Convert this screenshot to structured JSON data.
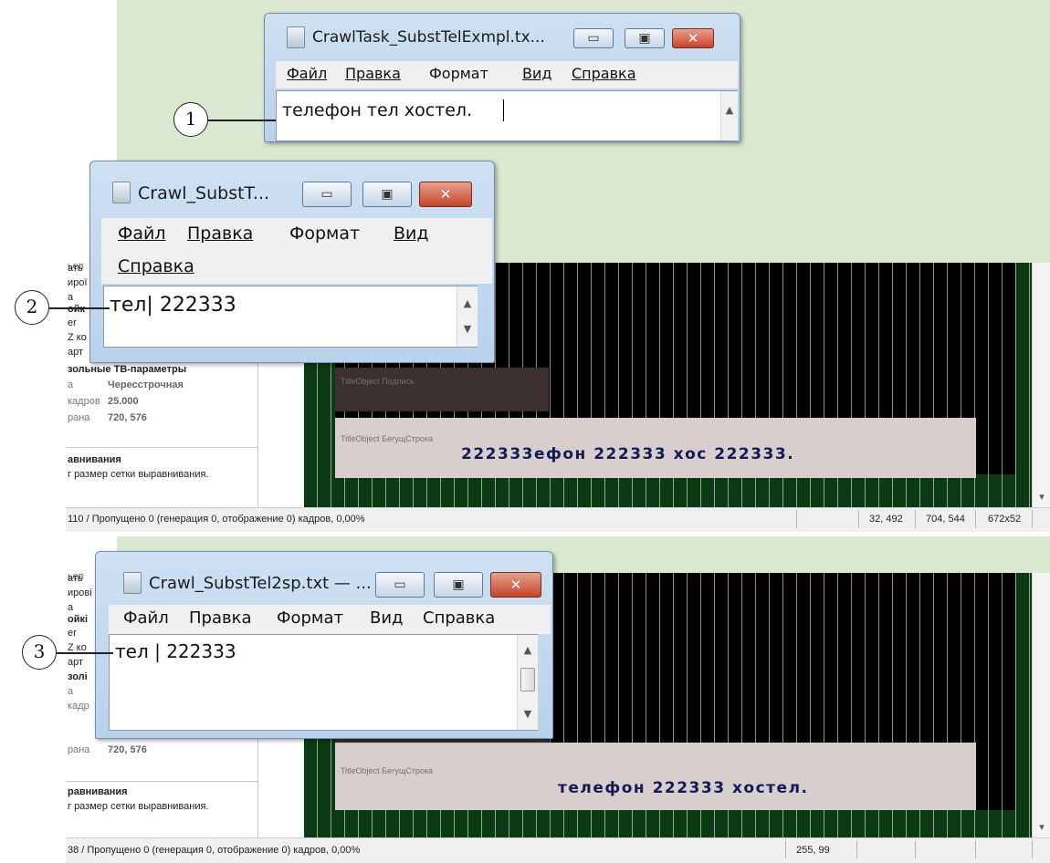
{
  "callouts": [
    "1",
    "2",
    "3"
  ],
  "window1": {
    "title": "CrawlTask_SubstTelExmpl.tx...",
    "menu": [
      "Файл",
      "Правка",
      "Формат",
      "Вид",
      "Справка"
    ],
    "text": "телефон тел хостел."
  },
  "window2": {
    "title": "Crawl_SubstT...",
    "menu": [
      "Файл",
      "Правка",
      "Формат",
      "Вид",
      "Справка"
    ],
    "text": "тел| 222333"
  },
  "window3": {
    "title": "Crawl_SubstTel2sp.txt — ...",
    "menu": [
      "Файл",
      "Правка",
      "Формат",
      "Вид",
      "Справка"
    ],
    "text": "тел | 222333"
  },
  "app1": {
    "left_fragments": [
      "ьев",
      "ать",
      "ирої",
      "а",
      "ойк",
      "er",
      "Z ко",
      "арт"
    ],
    "section_title": "зольные ТВ-параметры",
    "props": [
      {
        "label": "а",
        "value": "Чересстрочная"
      },
      {
        "label": "кадров",
        "value": "25.000"
      },
      {
        "label": "рана",
        "value": "720, 576"
      }
    ],
    "help_title": "авнивания",
    "help_text": "г размер сетки выравнивания.",
    "caption_label": "TitleObject Подпись",
    "crawl_label": "TitleObject БегущСтрока",
    "crawl_text": "222333ефон  222333  хос 222333.",
    "status": {
      "text": "110 / Пропущено 0 (генерация 0, отображение 0) кадров,  0,00%",
      "coords": "32, 492",
      "pos": "704, 544",
      "size": "672x52"
    }
  },
  "app2": {
    "left_fragments": [
      "ьев",
      "ать",
      "ирові",
      "а",
      "ойкі",
      "er",
      "Z ко",
      "арт",
      "золі",
      "а",
      "кадр"
    ],
    "props": [
      {
        "label": "рана",
        "value": "720, 576"
      }
    ],
    "help_title": "равнивания",
    "help_text": "г размер сетки выравнивания.",
    "crawl_label": "TitleObject БегущСтрока",
    "crawl_text": "телефон 222333 хостел.",
    "status": {
      "text": "38 / Пропущено 0 (генерация 0, отображение 0) кадров,  0,00%",
      "coords": "255, 99"
    }
  },
  "icons": {
    "minimize": "minimize-icon",
    "maximize": "maximize-icon",
    "close": "close-icon",
    "scroll_up": "scroll-up-arrow-icon",
    "scroll_down": "scroll-down-arrow-icon",
    "notepad": "notepad-icon"
  },
  "colors": {
    "background_green": "#dbe8d2",
    "canvas_green": "#0c3a12",
    "crawl_text": "#101c55",
    "close_red": "#c7432b"
  }
}
